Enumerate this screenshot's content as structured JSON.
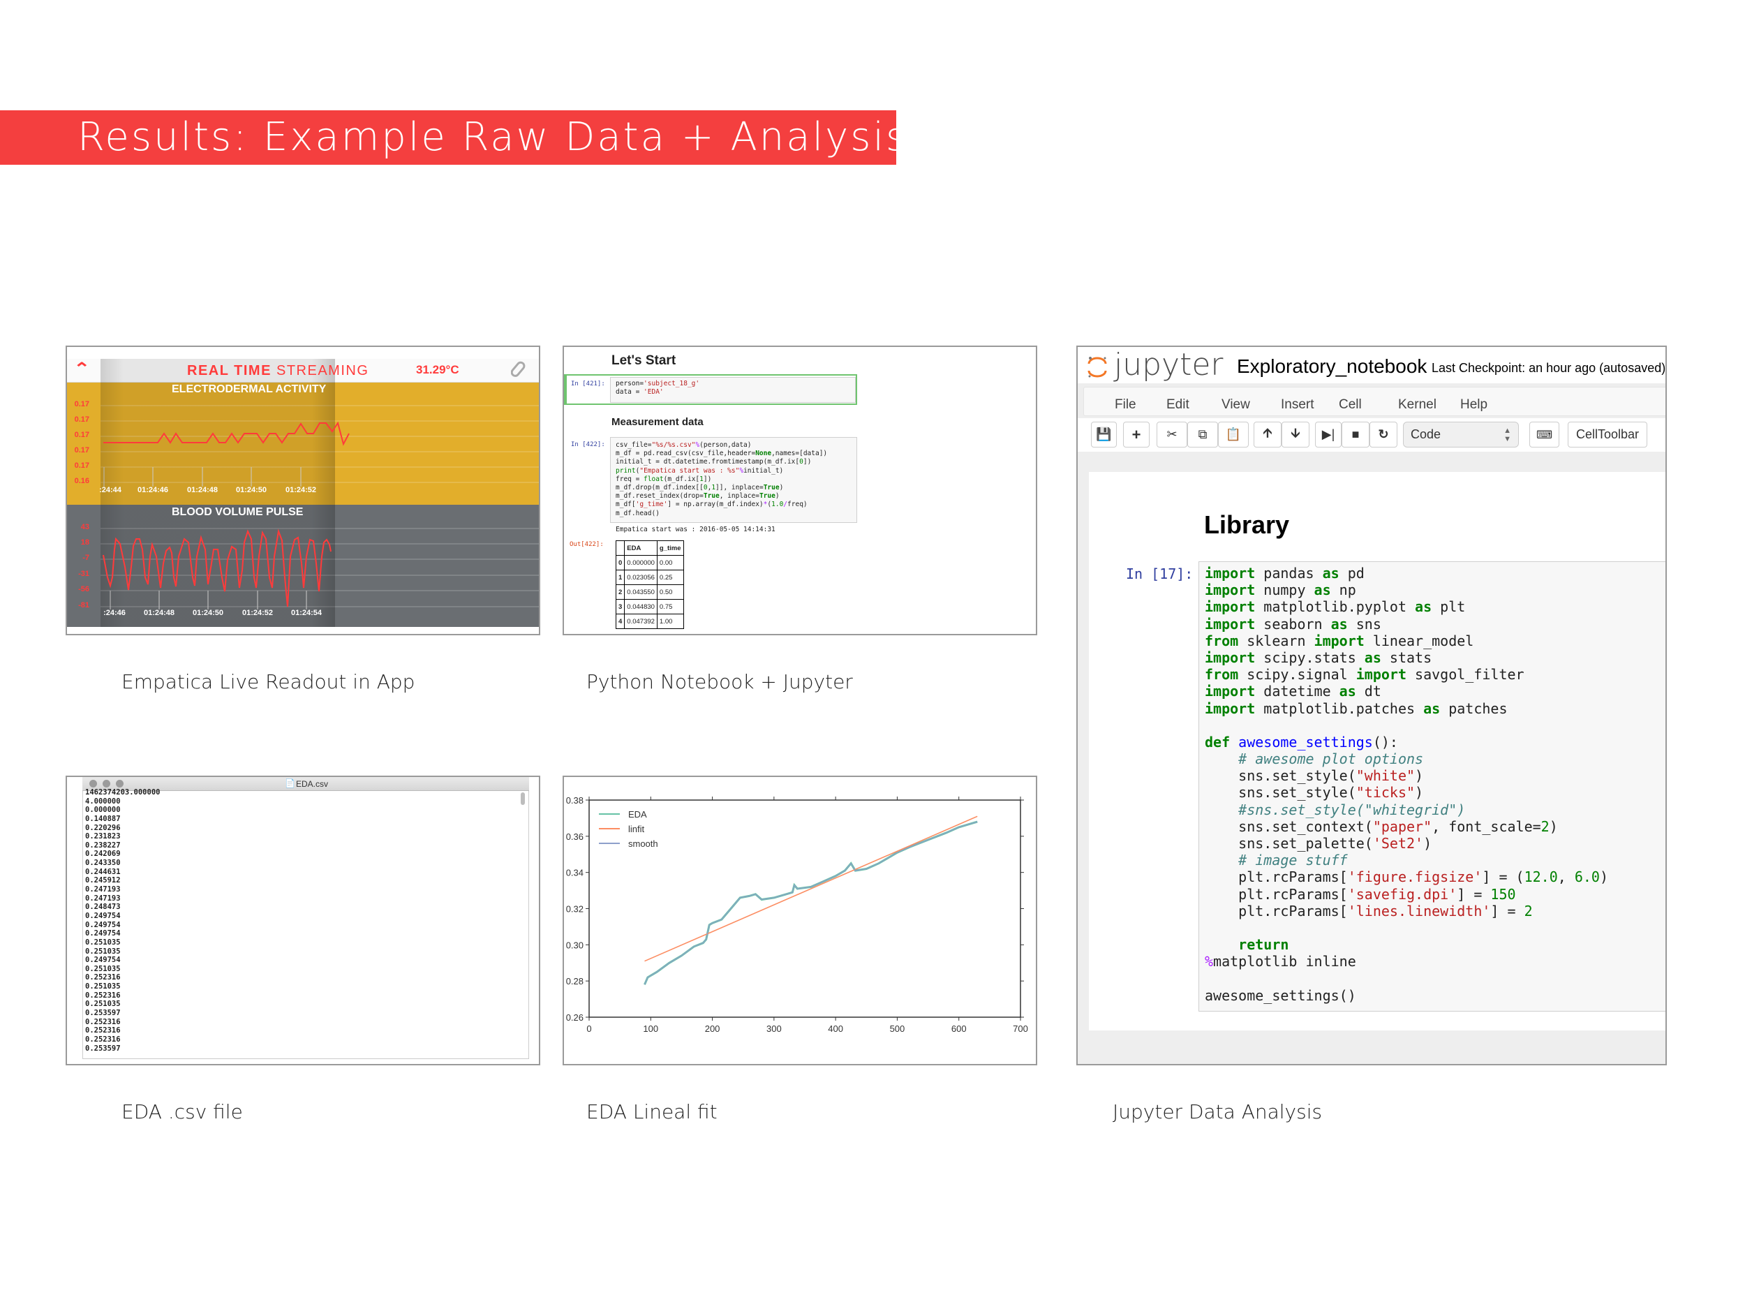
{
  "banner": {
    "title": "Results: Example Raw Data + Analysis",
    "color": "#f43f3f"
  },
  "captions": {
    "app": "Empatica Live Readout in App",
    "notebook": "Python Notebook + Jupyter",
    "csv": "EDA .csv file",
    "linfit": "EDA Lineal fit",
    "jupyter": "Jupyter Data Analysis"
  },
  "app": {
    "title_bold": "REAL TIME",
    "title_light": "STREAMING",
    "temperature": "31.29°C",
    "accent": "#ff3b3b",
    "eda": {
      "title": "ELECTRODERMAL ACTIVITY",
      "yticks": [
        "0.17",
        "0.17",
        "0.17",
        "0.17",
        "0.17",
        "0.16"
      ],
      "xticks": [
        ":24:44",
        "01:24:46",
        "01:24:48",
        "01:24:50",
        "01:24:52"
      ]
    },
    "bvp": {
      "title": "BLOOD VOLUME PULSE",
      "yticks": [
        "43",
        "18",
        "-7",
        "-31",
        "-56",
        "-81"
      ],
      "xticks": [
        ":24:46",
        "01:24:48",
        "01:24:50",
        "01:24:52",
        "01:24:54"
      ]
    }
  },
  "notebook": {
    "heading1": "Let's Start",
    "cell1_prompt": "In [421]:",
    "cell1_code": [
      [
        [
          "p",
          "person="
        ],
        [
          "s",
          "'subject_18_g'"
        ]
      ],
      [
        [
          "p",
          "data = "
        ],
        [
          "s",
          "'EDA'"
        ]
      ]
    ],
    "heading2": "Measurement data",
    "cell2_prompt": "In [422]:",
    "cell2_code": [
      [
        [
          "p",
          "csv_file="
        ],
        [
          "s",
          "\"%s/%s.csv\""
        ],
        [
          "o",
          "%"
        ],
        [
          "p",
          "(person,data)"
        ]
      ],
      [
        [
          "p",
          "m_df = pd.read_csv(csv_file,header="
        ],
        [
          "k",
          "None"
        ],
        [
          "p",
          ",names=[data])"
        ]
      ],
      [
        [
          "p",
          "initial_t = dt.datetime.fromtimestamp(m_df.ix["
        ],
        [
          "n",
          "0"
        ],
        [
          "p",
          "])"
        ]
      ],
      [
        [
          "b",
          "print"
        ],
        [
          "p",
          "("
        ],
        [
          "s",
          "\"Empatica start was : %s\""
        ],
        [
          "o",
          "%"
        ],
        [
          "p",
          "initial_t)"
        ]
      ],
      [
        [
          "p",
          "freq = "
        ],
        [
          "b",
          "float"
        ],
        [
          "p",
          "(m_df.ix["
        ],
        [
          "n",
          "1"
        ],
        [
          "p",
          "])"
        ]
      ],
      [
        [
          "p",
          "m_df.drop(m_df.index[["
        ],
        [
          "n",
          "0"
        ],
        [
          "p",
          ","
        ],
        [
          "n",
          "1"
        ],
        [
          "p",
          "]], inplace="
        ],
        [
          "k",
          "True"
        ],
        [
          "p",
          ")"
        ]
      ],
      [
        [
          "p",
          "m_df.reset_index(drop="
        ],
        [
          "k",
          "True"
        ],
        [
          "p",
          ", inplace="
        ],
        [
          "k",
          "True"
        ],
        [
          "p",
          ")"
        ]
      ],
      [
        [
          "p",
          "m_df["
        ],
        [
          "s",
          "'g_time'"
        ],
        [
          "p",
          "] = np.array(m_df.index)"
        ],
        [
          "o",
          "*"
        ],
        [
          "p",
          "("
        ],
        [
          "n",
          "1.0"
        ],
        [
          "o",
          "/"
        ],
        [
          "p",
          "freq)"
        ]
      ],
      [
        [
          "p",
          "m_df.head()"
        ]
      ]
    ],
    "stdout": "Empatica start was : 2016-05-05 14:14:31",
    "out_prompt": "Out[422]:",
    "table": {
      "columns": [
        "",
        "EDA",
        "g_time"
      ],
      "rows": [
        [
          "0",
          "0.000000",
          "0.00"
        ],
        [
          "1",
          "0.023056",
          "0.25"
        ],
        [
          "2",
          "0.043550",
          "0.50"
        ],
        [
          "3",
          "0.044830",
          "0.75"
        ],
        [
          "4",
          "0.047392",
          "1.00"
        ]
      ]
    }
  },
  "csv": {
    "window_title": "EDA.csv",
    "lines": [
      "1462374203.000000",
      "4.000000",
      "0.000000",
      "0.140887",
      "0.220296",
      "0.231823",
      "0.238227",
      "0.242069",
      "0.243350",
      "0.244631",
      "0.245912",
      "0.247193",
      "0.247193",
      "0.248473",
      "0.249754",
      "0.249754",
      "0.249754",
      "0.251035",
      "0.251035",
      "0.249754",
      "0.251035",
      "0.252316",
      "0.251035",
      "0.252316",
      "0.251035",
      "0.253597",
      "0.252316",
      "0.252316",
      "0.252316",
      "0.253597"
    ]
  },
  "chart_data": {
    "type": "line",
    "title": "",
    "xlabel": "",
    "ylabel": "",
    "xlim": [
      0,
      700
    ],
    "ylim": [
      0.26,
      0.38
    ],
    "xticks": [
      "0",
      "100",
      "200",
      "300",
      "400",
      "500",
      "600",
      "700"
    ],
    "yticks": [
      "0.26",
      "0.28",
      "0.30",
      "0.32",
      "0.34",
      "0.36",
      "0.38"
    ],
    "grid": false,
    "legend": "top-left",
    "series": [
      {
        "name": "EDA",
        "color": "#66c2a5",
        "x": [
          90,
          95,
          110,
          130,
          150,
          170,
          185,
          190,
          195,
          200,
          215,
          230,
          245,
          260,
          270,
          280,
          300,
          320,
          330,
          333,
          338,
          360,
          380,
          400,
          415,
          425,
          432,
          450,
          470,
          500,
          520,
          550,
          580,
          600,
          630
        ],
        "y": [
          0.278,
          0.282,
          0.285,
          0.29,
          0.294,
          0.299,
          0.301,
          0.303,
          0.311,
          0.312,
          0.314,
          0.32,
          0.326,
          0.327,
          0.328,
          0.325,
          0.326,
          0.328,
          0.329,
          0.333,
          0.331,
          0.332,
          0.335,
          0.338,
          0.341,
          0.345,
          0.341,
          0.342,
          0.345,
          0.351,
          0.354,
          0.358,
          0.362,
          0.365,
          0.368
        ]
      },
      {
        "name": "linfit",
        "color": "#fc8d62",
        "x": [
          90,
          630
        ],
        "y": [
          0.291,
          0.371
        ]
      },
      {
        "name": "smooth",
        "color": "#8da0cb",
        "x": [
          90,
          95,
          110,
          130,
          150,
          170,
          185,
          190,
          195,
          200,
          215,
          230,
          245,
          260,
          270,
          280,
          300,
          320,
          330,
          333,
          338,
          360,
          380,
          400,
          415,
          425,
          432,
          450,
          470,
          500,
          520,
          550,
          580,
          600,
          630
        ],
        "y": [
          0.278,
          0.282,
          0.285,
          0.29,
          0.294,
          0.299,
          0.301,
          0.303,
          0.311,
          0.312,
          0.314,
          0.32,
          0.326,
          0.327,
          0.328,
          0.325,
          0.326,
          0.328,
          0.329,
          0.333,
          0.331,
          0.332,
          0.335,
          0.338,
          0.341,
          0.345,
          0.341,
          0.342,
          0.345,
          0.351,
          0.354,
          0.358,
          0.362,
          0.365,
          0.368
        ]
      }
    ]
  },
  "jupyter": {
    "logo_text": "jupyter",
    "notebook_name": "Exploratory_notebook",
    "checkpoint": "Last Checkpoint: an hour ago (autosaved)",
    "menu": [
      "File",
      "Edit",
      "View",
      "Insert",
      "Cell",
      "Kernel",
      "Help"
    ],
    "cell_type": "Code",
    "celltoolbar": "CellToolbar",
    "heading": "Library",
    "prompt": "In [17]:",
    "code": [
      [
        [
          "k",
          "import"
        ],
        [
          "p",
          " pandas "
        ],
        [
          "k",
          "as"
        ],
        [
          "p",
          " pd"
        ]
      ],
      [
        [
          "k",
          "import"
        ],
        [
          "p",
          " numpy "
        ],
        [
          "k",
          "as"
        ],
        [
          "p",
          " np"
        ]
      ],
      [
        [
          "k",
          "import"
        ],
        [
          "p",
          " matplotlib.pyplot "
        ],
        [
          "k",
          "as"
        ],
        [
          "p",
          " plt"
        ]
      ],
      [
        [
          "k",
          "import"
        ],
        [
          "p",
          " seaborn "
        ],
        [
          "k",
          "as"
        ],
        [
          "p",
          " sns"
        ]
      ],
      [
        [
          "k",
          "from"
        ],
        [
          "p",
          " sklearn "
        ],
        [
          "k",
          "import"
        ],
        [
          "p",
          " linear_model"
        ]
      ],
      [
        [
          "k",
          "import"
        ],
        [
          "p",
          " scipy.stats "
        ],
        [
          "k",
          "as"
        ],
        [
          "p",
          " stats"
        ]
      ],
      [
        [
          "k",
          "from"
        ],
        [
          "p",
          " scipy.signal "
        ],
        [
          "k",
          "import"
        ],
        [
          "p",
          " savgol_filter"
        ]
      ],
      [
        [
          "k",
          "import"
        ],
        [
          "p",
          " datetime "
        ],
        [
          "k",
          "as"
        ],
        [
          "p",
          " dt"
        ]
      ],
      [
        [
          "k",
          "import"
        ],
        [
          "p",
          " matplotlib.patches "
        ],
        [
          "k",
          "as"
        ],
        [
          "p",
          " patches"
        ]
      ],
      [
        [
          "p",
          ""
        ]
      ],
      [
        [
          "k",
          "def"
        ],
        [
          "p",
          " "
        ],
        [
          "f",
          "awesome_settings"
        ],
        [
          "p",
          "():"
        ]
      ],
      [
        [
          "p",
          "    "
        ],
        [
          "c",
          "# awesome plot options"
        ]
      ],
      [
        [
          "p",
          "    sns.set_style("
        ],
        [
          "s",
          "\"white\""
        ],
        [
          "p",
          ")"
        ]
      ],
      [
        [
          "p",
          "    sns.set_style("
        ],
        [
          "s",
          "\"ticks\""
        ],
        [
          "p",
          ")"
        ]
      ],
      [
        [
          "p",
          "    "
        ],
        [
          "c",
          "#sns.set_style(\"whitegrid\")"
        ]
      ],
      [
        [
          "p",
          "    sns.set_context("
        ],
        [
          "s",
          "\"paper\""
        ],
        [
          "p",
          ", font_scale="
        ],
        [
          "n",
          "2"
        ],
        [
          "p",
          ")"
        ]
      ],
      [
        [
          "p",
          "    sns.set_palette("
        ],
        [
          "s",
          "'Set2'"
        ],
        [
          "p",
          ")"
        ]
      ],
      [
        [
          "p",
          "    "
        ],
        [
          "c",
          "# image stuff"
        ]
      ],
      [
        [
          "p",
          "    plt.rcParams["
        ],
        [
          "s",
          "'figure.figsize'"
        ],
        [
          "p",
          "] = ("
        ],
        [
          "n",
          "12.0"
        ],
        [
          "p",
          ", "
        ],
        [
          "n",
          "6.0"
        ],
        [
          "p",
          ")"
        ]
      ],
      [
        [
          "p",
          "    plt.rcParams["
        ],
        [
          "s",
          "'savefig.dpi'"
        ],
        [
          "p",
          "] = "
        ],
        [
          "n",
          "150"
        ]
      ],
      [
        [
          "p",
          "    plt.rcParams["
        ],
        [
          "s",
          "'lines.linewidth'"
        ],
        [
          "p",
          "] = "
        ],
        [
          "n",
          "2"
        ]
      ],
      [
        [
          "p",
          ""
        ]
      ],
      [
        [
          "p",
          "    "
        ],
        [
          "k",
          "return"
        ]
      ],
      [
        [
          "m",
          "%"
        ],
        [
          "p",
          "matplotlib inline"
        ]
      ],
      [
        [
          "p",
          ""
        ]
      ],
      [
        [
          "p",
          "awesome_settings()"
        ]
      ]
    ]
  }
}
